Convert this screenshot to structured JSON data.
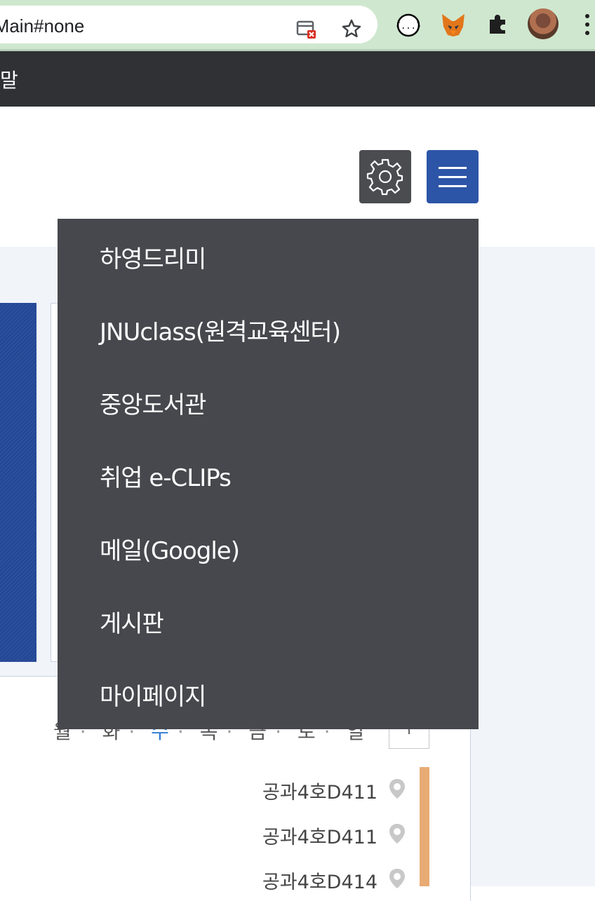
{
  "browser": {
    "url_fragment": "tuMain#none",
    "icons": [
      "tab-blocked-icon",
      "bookmark-star-icon",
      "json-extension-icon",
      "metamask-fox-icon",
      "extensions-puzzle-icon",
      "profile-avatar",
      "more-menu-icon"
    ]
  },
  "top_strip": {
    "text": "말"
  },
  "header": {
    "settings_icon": "gear-icon",
    "menu_icon": "hamburger-icon"
  },
  "dropdown": {
    "items": [
      {
        "label": "하영드리미"
      },
      {
        "label": "JNUclass(원격교육센터)"
      },
      {
        "label": "중앙도서관"
      },
      {
        "label": "취업 e-CLIPs"
      },
      {
        "label": "메일(Google)"
      },
      {
        "label": "게시판"
      },
      {
        "label": "마이페이지"
      }
    ]
  },
  "schedule": {
    "days": [
      "월",
      "화",
      "수",
      "목",
      "금",
      "토",
      "일"
    ],
    "active_day": "수",
    "rooms": [
      {
        "label": "공과4호D411"
      },
      {
        "label": "공과4호D411"
      },
      {
        "label": "공과4호D414"
      }
    ]
  },
  "colors": {
    "menu_button": "#2d55a7",
    "settings_button": "#4a4c50",
    "dropdown_bg": "#46484d",
    "dark_strip": "#2f3135",
    "accent_day": "#2d7ad6",
    "orange_bar": "#e8ab74"
  }
}
